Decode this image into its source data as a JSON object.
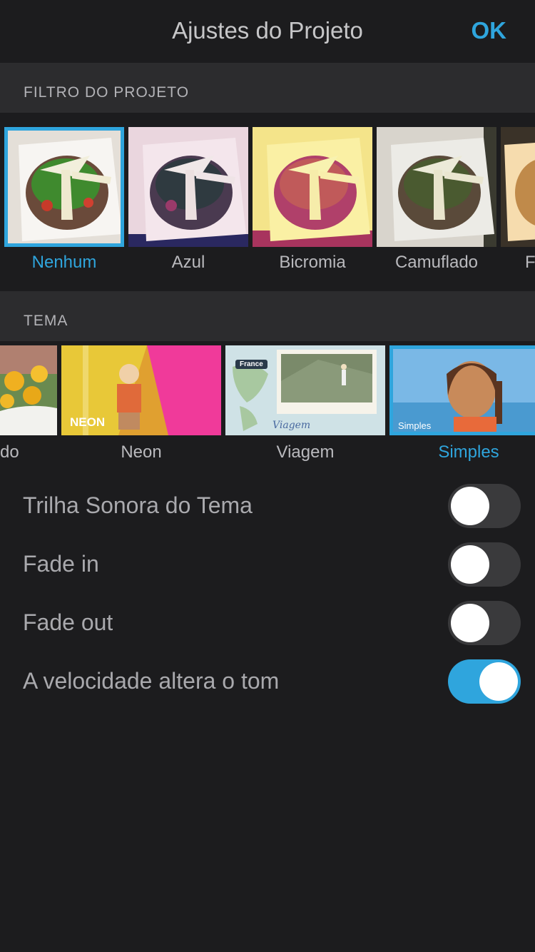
{
  "header": {
    "title": "Ajustes do Projeto",
    "ok_label": "OK"
  },
  "filters": {
    "section_title": "FILTRO DO PROJETO",
    "items": [
      {
        "label": "Nenhum",
        "selected": true
      },
      {
        "label": "Azul",
        "selected": false
      },
      {
        "label": "Bicromia",
        "selected": false
      },
      {
        "label": "Camuflado",
        "selected": false
      },
      {
        "label": "F",
        "selected": false
      }
    ]
  },
  "themes": {
    "section_title": "TEMA",
    "items": [
      {
        "label": "do",
        "selected": false
      },
      {
        "label": "Neon",
        "selected": false,
        "badge": "NEON"
      },
      {
        "label": "Viagem",
        "selected": false,
        "badge": "France",
        "script": "Viagem"
      },
      {
        "label": "Simples",
        "selected": true,
        "badge": "Simples"
      }
    ]
  },
  "settings": [
    {
      "label": "Trilha Sonora do Tema",
      "on": false
    },
    {
      "label": "Fade in",
      "on": false
    },
    {
      "label": "Fade out",
      "on": false
    },
    {
      "label": "A velocidade altera o tom",
      "on": true
    }
  ],
  "colors": {
    "accent": "#2fa5dd",
    "background": "#1c1c1e",
    "section": "#2c2c2e"
  }
}
